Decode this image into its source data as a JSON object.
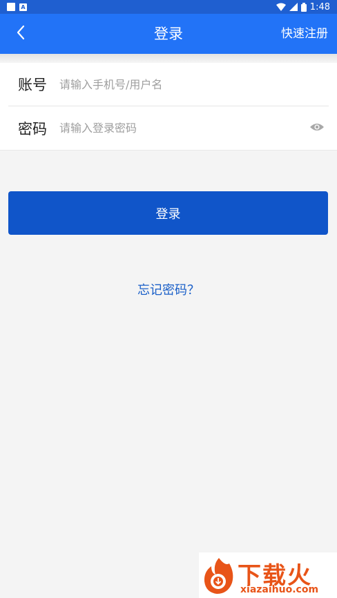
{
  "status_bar": {
    "time": "1:48",
    "left_icons": [
      "notification-square-icon",
      "app-a-icon"
    ],
    "right_icons": [
      "wifi-icon",
      "signal-icon",
      "battery-icon"
    ]
  },
  "app_bar": {
    "back_icon": "chevron-left-icon",
    "title": "登录",
    "register_label": "快速注册",
    "color": "#2273f7"
  },
  "form": {
    "account": {
      "label": "账号",
      "value": "",
      "placeholder": "请输入手机号/用户名"
    },
    "password": {
      "label": "密码",
      "value": "",
      "placeholder": "请输入登录密码",
      "toggle_icon": "eye-icon"
    }
  },
  "login_button": {
    "label": "登录",
    "color": "#1055c9"
  },
  "forgot_password": {
    "label": "忘记密码？",
    "color": "#1a5fc8"
  },
  "watermark": {
    "title": "下载火",
    "url": "xiazaihuo.com"
  }
}
